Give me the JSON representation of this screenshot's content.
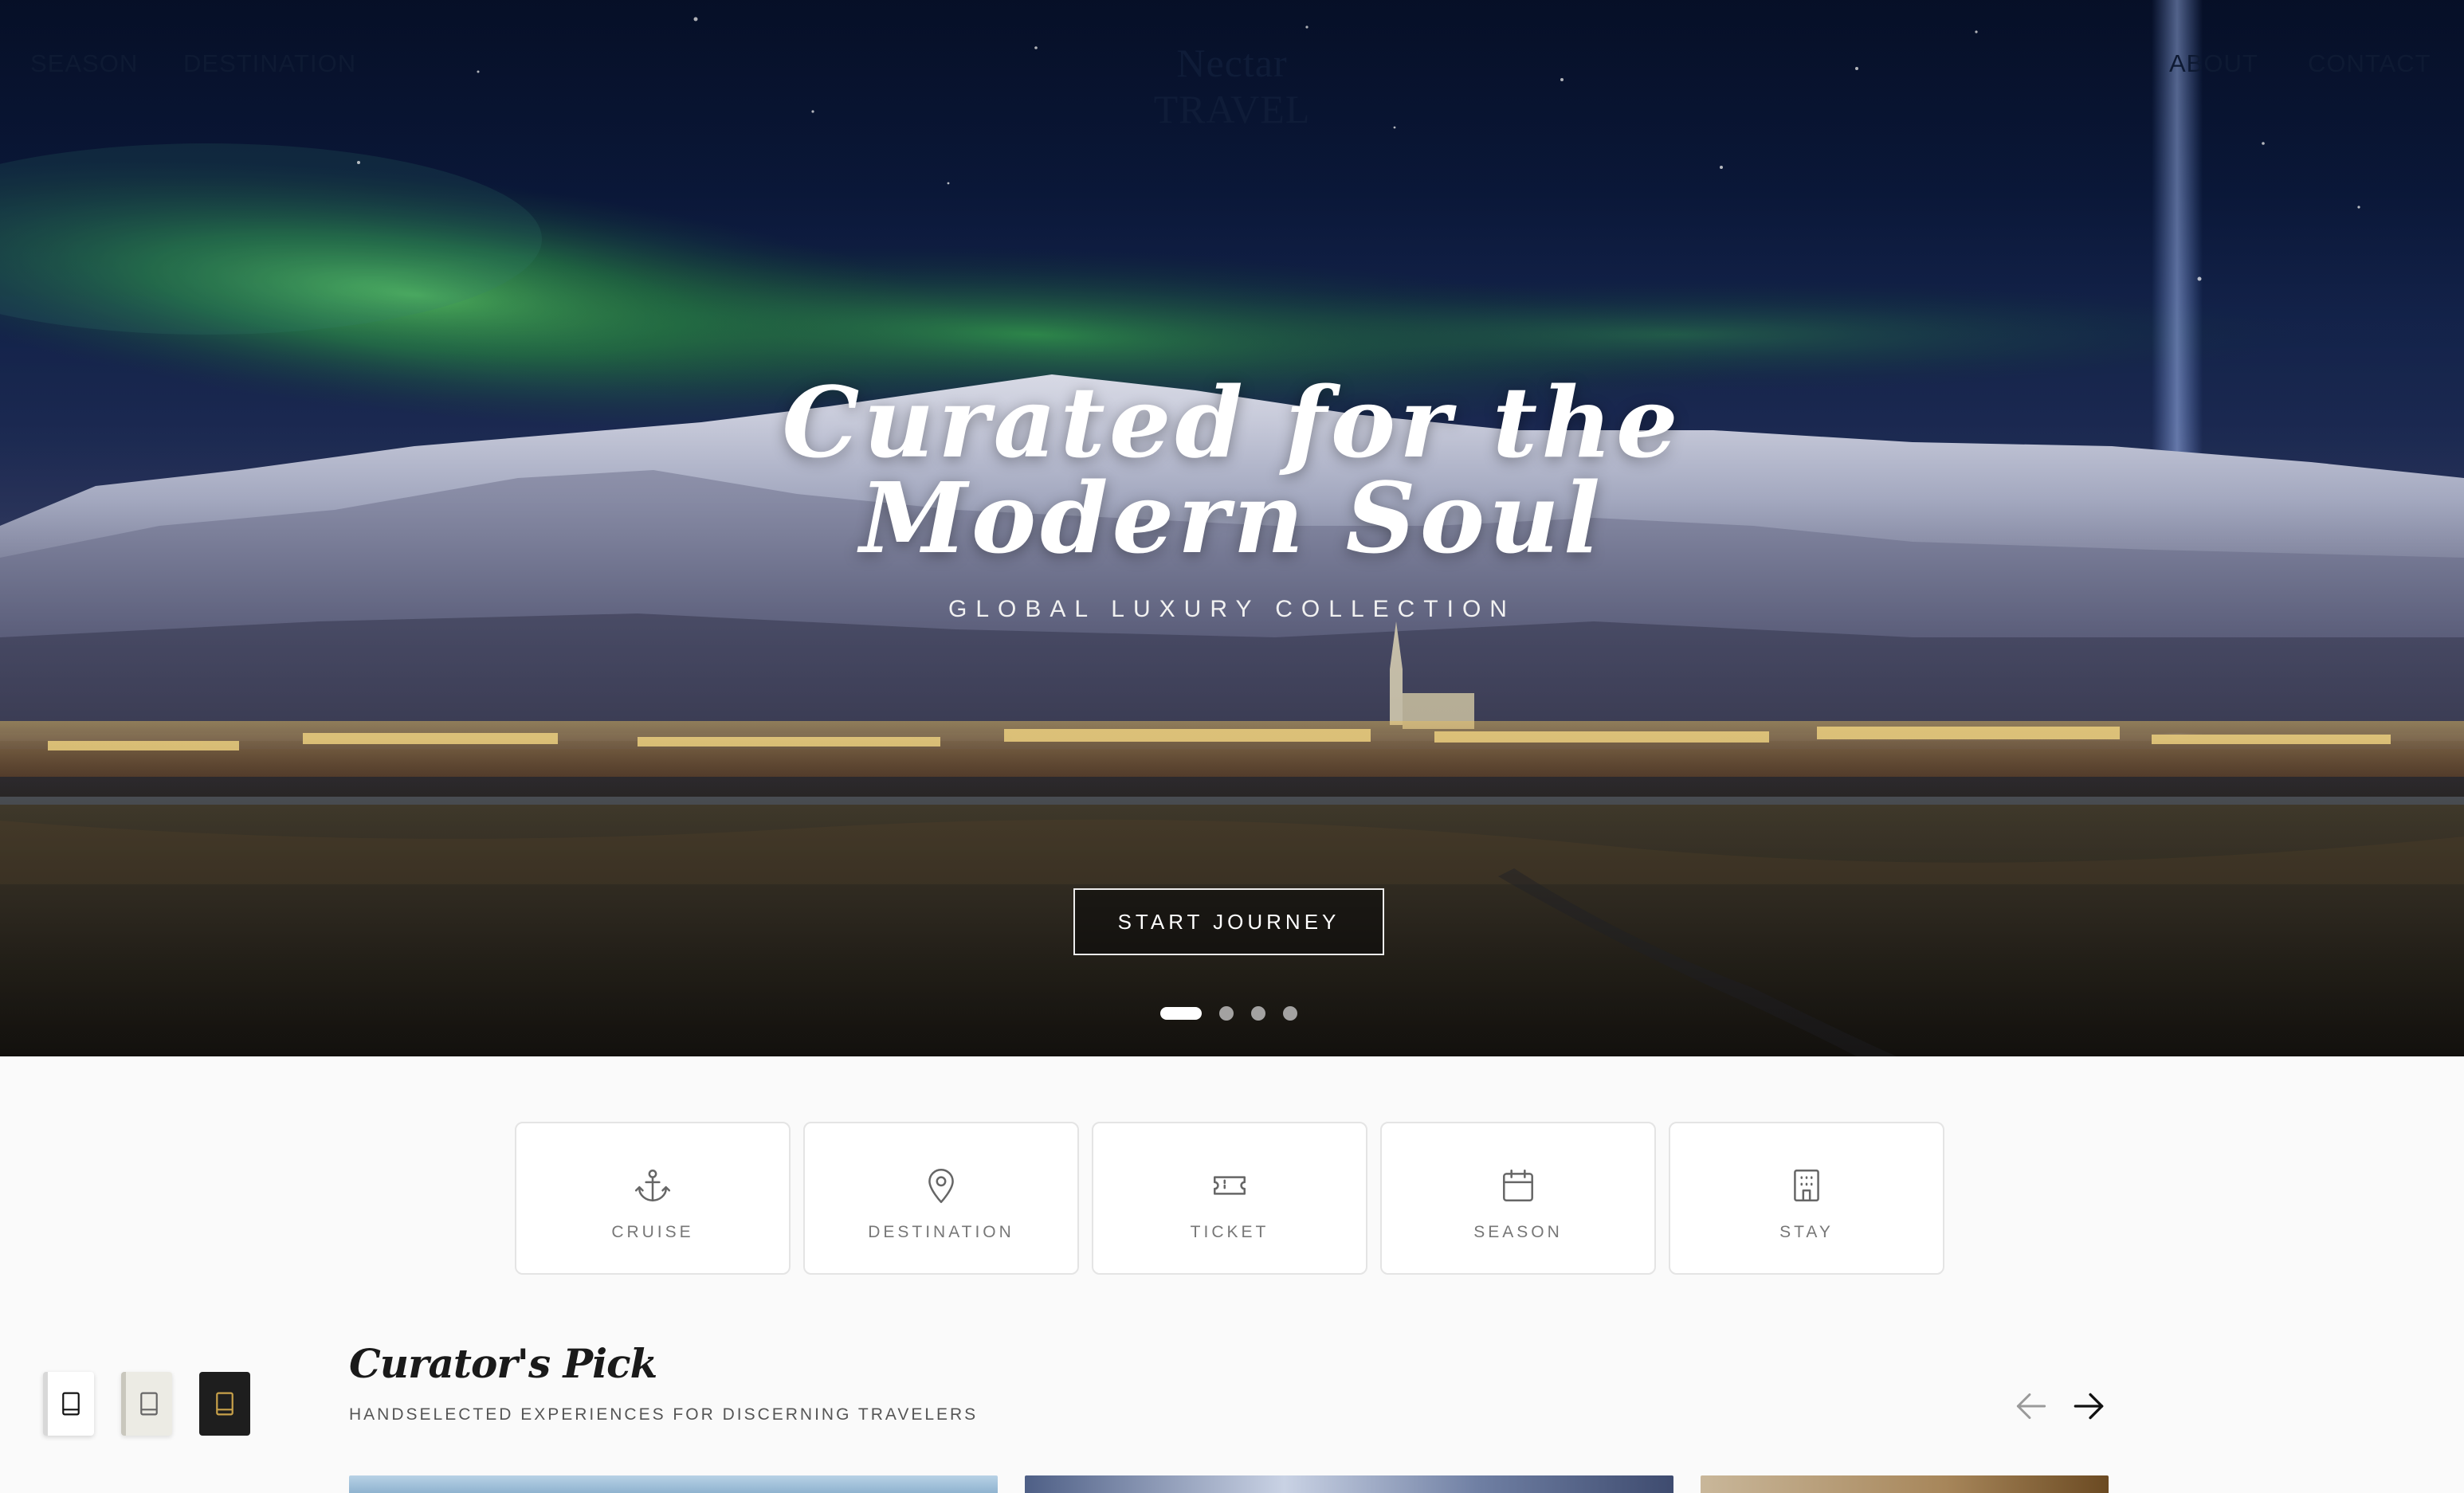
{
  "nav": {
    "brand": "Nectar TRAVEL",
    "left": [
      "SEASON",
      "DESTINATION"
    ],
    "right": [
      "ABOUT",
      "CONTACT"
    ]
  },
  "hero": {
    "title_line1": "Curated for the",
    "title_line2": "Modern Soul",
    "subtitle": "GLOBAL LUXURY COLLECTION",
    "cta": "START JOURNEY",
    "slides": 4,
    "active_slide": 1
  },
  "categories": [
    {
      "label": "CRUISE",
      "icon": "anchor-icon"
    },
    {
      "label": "DESTINATION",
      "icon": "map-pin-icon"
    },
    {
      "label": "TICKET",
      "icon": "ticket-icon"
    },
    {
      "label": "SEASON",
      "icon": "calendar-icon"
    },
    {
      "label": "STAY",
      "icon": "building-icon"
    }
  ],
  "curators_pick": {
    "title": "Curator's Pick",
    "subtitle": "HANDSELECTED EXPERIENCES FOR DISCERNING TRAVELERS"
  },
  "theme_switcher": [
    {
      "name": "light",
      "icon": "book-icon",
      "color": "#ffffff"
    },
    {
      "name": "paper",
      "icon": "book-icon",
      "color": "#ecebe4"
    },
    {
      "name": "dark",
      "icon": "book-icon",
      "color": "#1e1e1e"
    }
  ],
  "colors": {
    "nav_text": "#0e1a33",
    "hero_text": "#ffffff",
    "accent_gold": "#c9a24a",
    "card_border": "#e4e4e4"
  }
}
